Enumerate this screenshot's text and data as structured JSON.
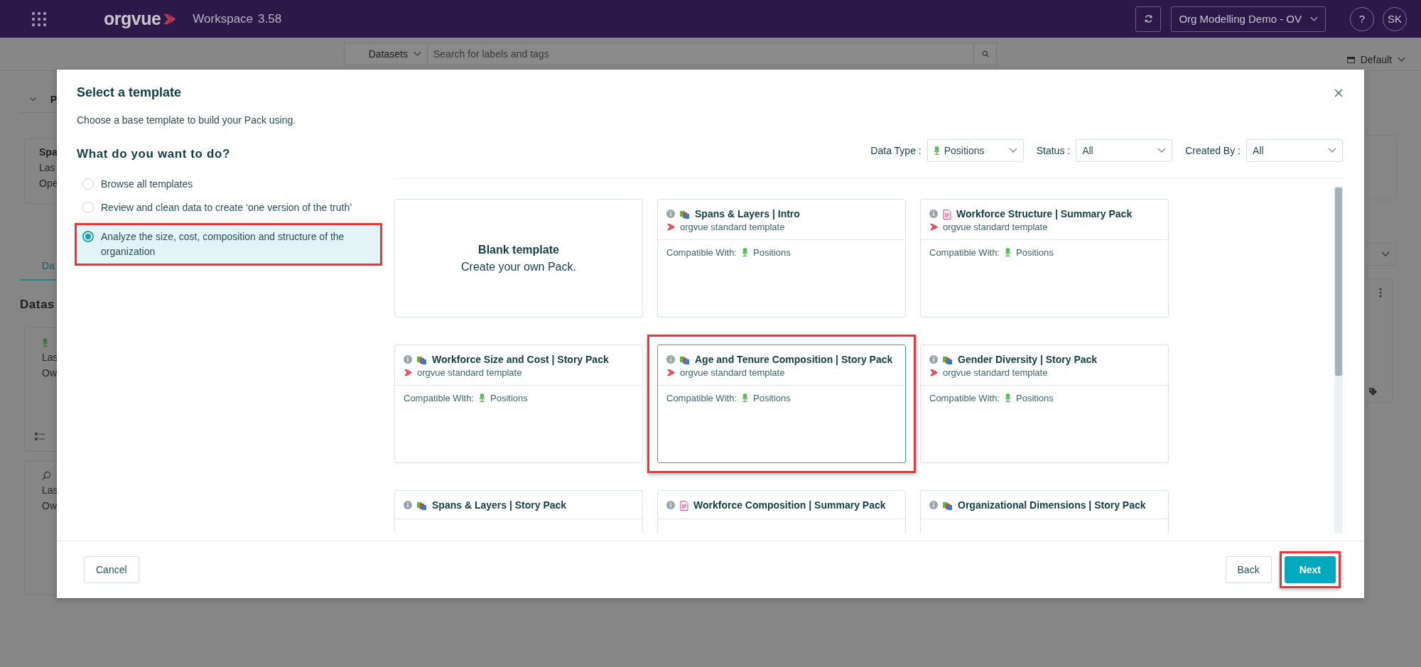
{
  "app_bar": {
    "logo": "orgvue",
    "product": "Workspace",
    "version": "3.58",
    "workspace": "Org Modelling Demo - OV",
    "help": "?",
    "user_initials": "SK"
  },
  "toolbar": {
    "scope": "Datasets",
    "search": {
      "placeholder": "Search for labels and tags"
    },
    "view": "Default"
  },
  "background": {
    "section_letter": "P",
    "pack_card": [
      "Spa",
      "Las",
      "Ope"
    ],
    "tab": "Da",
    "heading": "Datas",
    "dataset_cards": [
      {
        "kind": "positions",
        "lines": [
          "Las",
          "Ow"
        ]
      },
      {
        "kind": "search",
        "lines": [
          "Las",
          "Ow"
        ]
      }
    ]
  },
  "dialog": {
    "title": "Select a template",
    "subtitle": "Choose a base template to build your Pack using.",
    "question": "What do you want to do?",
    "options": [
      {
        "label": "Browse all templates",
        "selected": false,
        "highlighted": false
      },
      {
        "label": "Review and clean data to create ‘one version of the truth’",
        "selected": false,
        "highlighted": false
      },
      {
        "label": "Analyze the size, cost, composition and structure of the organization",
        "selected": true,
        "highlighted": true
      }
    ],
    "filters": [
      {
        "label": "Data Type :",
        "value": "Positions",
        "kind": "positions"
      },
      {
        "label": "Status :",
        "value": "All",
        "kind": "plain"
      },
      {
        "label": "Created By :",
        "value": "All",
        "kind": "plain"
      }
    ],
    "templates": [
      {
        "kind": "blank",
        "title": "Blank template",
        "description": "Create your own Pack."
      },
      {
        "kind": "story",
        "title": "Spans & Layers | Intro",
        "source": "orgvue standard template",
        "compatible_label": "Compatible With:",
        "compatible": "Positions",
        "selected": false,
        "highlighted": false
      },
      {
        "kind": "summary",
        "title": "Workforce Structure | Summary Pack",
        "source": "orgvue standard template",
        "compatible_label": "Compatible With:",
        "compatible": "Positions",
        "selected": false,
        "highlighted": false
      },
      {
        "kind": "story",
        "title": "Workforce Size and Cost | Story Pack",
        "source": "orgvue standard template",
        "compatible_label": "Compatible With:",
        "compatible": "Positions",
        "selected": false,
        "highlighted": false
      },
      {
        "kind": "story",
        "title": "Age and Tenure Composition | Story Pack",
        "source": "orgvue standard template",
        "compatible_label": "Compatible With:",
        "compatible": "Positions",
        "selected": true,
        "highlighted": true
      },
      {
        "kind": "story",
        "title": "Gender Diversity | Story Pack",
        "source": "orgvue standard template",
        "compatible_label": "Compatible With:",
        "compatible": "Positions",
        "selected": false,
        "highlighted": false
      },
      {
        "kind": "story",
        "title": "Spans & Layers | Story Pack",
        "selected": false,
        "highlighted": false
      },
      {
        "kind": "summary",
        "title": "Workforce Composition | Summary Pack",
        "selected": false,
        "highlighted": false
      },
      {
        "kind": "story",
        "title": "Organizational Dimensions | Story Pack",
        "selected": false,
        "highlighted": false
      }
    ],
    "buttons": [
      {
        "label": "Cancel",
        "kind": "secondary",
        "highlighted": false
      },
      {
        "label": "Back",
        "kind": "secondary",
        "highlighted": false
      },
      {
        "label": "Next",
        "kind": "primary",
        "highlighted": true
      }
    ]
  }
}
